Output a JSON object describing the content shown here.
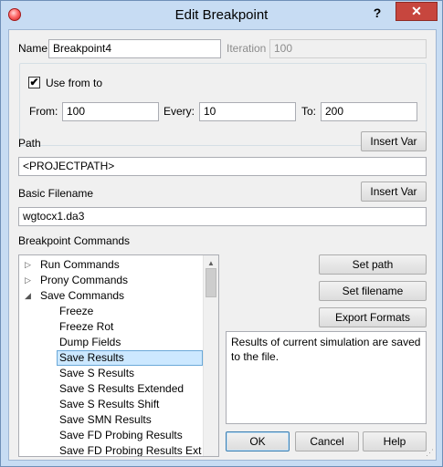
{
  "window": {
    "title": "Edit Breakpoint",
    "help_glyph": "?",
    "close_glyph": "✕"
  },
  "name": {
    "label": "Name",
    "value": "Breakpoint4"
  },
  "iteration": {
    "label": "Iteration",
    "value": "100"
  },
  "use_from_to": {
    "label": "Use from to",
    "checked": true
  },
  "from": {
    "label": "From:",
    "value": "100"
  },
  "every": {
    "label": "Every:",
    "value": "10"
  },
  "to": {
    "label": "To:",
    "value": "200"
  },
  "path": {
    "label": "Path",
    "value": "<PROJECTPATH>",
    "insert_label": "Insert Var"
  },
  "basic_filename": {
    "label": "Basic Filename",
    "value": "wgtocx1.da3",
    "insert_label": "Insert Var"
  },
  "commands": {
    "label": "Breakpoint Commands",
    "items": [
      {
        "label": "Run Commands",
        "expander": "collapsed"
      },
      {
        "label": "Prony Commands",
        "expander": "collapsed"
      },
      {
        "label": "Save Commands",
        "expander": "expanded"
      },
      {
        "label": "Freeze"
      },
      {
        "label": "Freeze Rot"
      },
      {
        "label": "Dump Fields"
      },
      {
        "label": "Save Results",
        "selected": true
      },
      {
        "label": "Save S Results"
      },
      {
        "label": "Save S Results Extended"
      },
      {
        "label": "Save S Results Shift"
      },
      {
        "label": "Save SMN Results"
      },
      {
        "label": "Save FD Probing Results"
      },
      {
        "label": "Save FD Probing Results Ext"
      }
    ]
  },
  "side_buttons": {
    "set_path": "Set path",
    "set_filename": "Set filename",
    "export_formats": "Export Formats"
  },
  "description": "Results of current simulation are saved to the file.",
  "footer": {
    "ok": "OK",
    "cancel": "Cancel",
    "help": "Help"
  }
}
